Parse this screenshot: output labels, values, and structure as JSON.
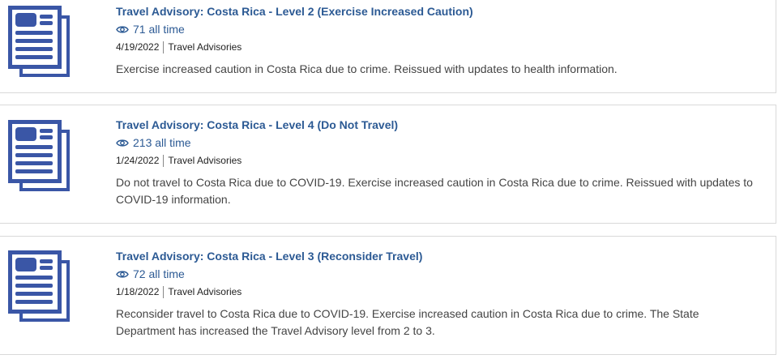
{
  "colors": {
    "link": "#2c5a94",
    "icon": "#3a56a6",
    "text": "#444444",
    "border": "#d9d9d9"
  },
  "items": [
    {
      "icon": "document-icon",
      "title": "Travel Advisory: Costa Rica - Level 2 (Exercise Increased Caution)",
      "views": "71 all time",
      "date": "4/19/2022",
      "category": "Travel Advisories",
      "description": "Exercise increased caution in Costa Rica due to crime. Reissued with updates to health information."
    },
    {
      "icon": "document-icon",
      "title": "Travel Advisory: Costa Rica - Level 4 (Do Not Travel)",
      "views": "213 all time",
      "date": "1/24/2022",
      "category": "Travel Advisories",
      "description": "Do not travel to Costa Rica due to COVID-19. Exercise increased caution in Costa Rica due to crime. Reissued with updates to COVID-19 information."
    },
    {
      "icon": "document-icon",
      "title": "Travel Advisory: Costa Rica - Level 3 (Reconsider Travel)",
      "views": "72 all time",
      "date": "1/18/2022",
      "category": "Travel Advisories",
      "description": "Reconsider travel to Costa Rica due to COVID-19. Exercise increased caution in Costa Rica due to crime. The State Department has increased the Travel Advisory level from 2 to 3."
    }
  ]
}
